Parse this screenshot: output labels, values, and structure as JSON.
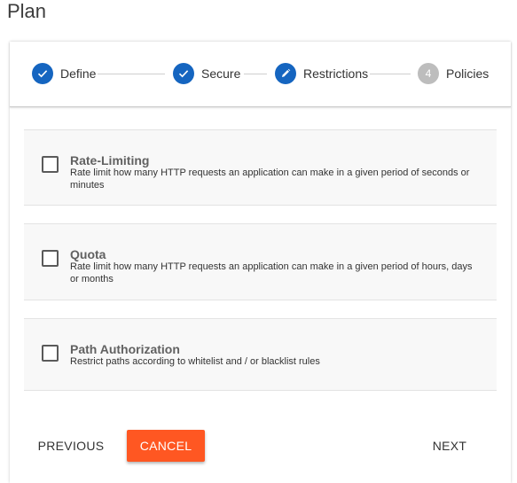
{
  "page": {
    "title": "Plan"
  },
  "stepper": {
    "steps": [
      {
        "label": "Define",
        "state": "complete",
        "icon": "check-icon"
      },
      {
        "label": "Secure",
        "state": "complete",
        "icon": "check-icon"
      },
      {
        "label": "Restrictions",
        "state": "active",
        "icon": "pencil-icon"
      },
      {
        "label": "Policies",
        "state": "inactive",
        "number": "4"
      }
    ],
    "colors": {
      "active": "#1565c0",
      "inactive": "#bdbdbd"
    }
  },
  "options": [
    {
      "title": "Rate-Limiting",
      "description": "Rate limit how many HTTP requests an application can make in a given period of seconds or minutes",
      "checked": false
    },
    {
      "title": "Quota",
      "description": "Rate limit how many HTTP requests an application can make in a given period of hours, days or months",
      "checked": false
    },
    {
      "title": "Path Authorization",
      "description": "Restrict paths according to whitelist and / or blacklist rules",
      "checked": false
    }
  ],
  "actions": {
    "previous_label": "PREVIOUS",
    "cancel_label": "CANCEL",
    "next_label": "NEXT",
    "cancel_color": "#ff5722"
  }
}
